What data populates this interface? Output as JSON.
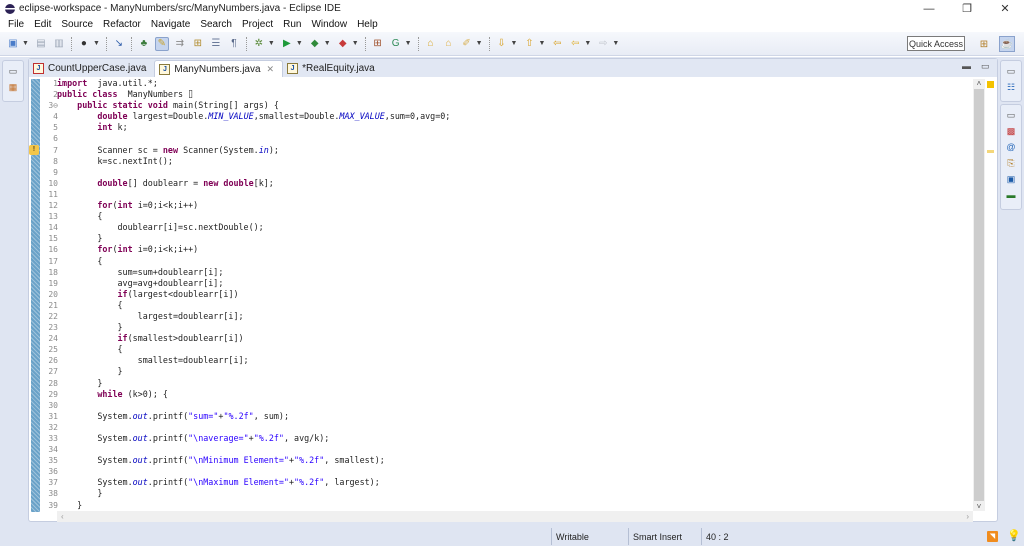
{
  "window": {
    "title": "eclipse-workspace - ManyNumbers/src/ManyNumbers.java - Eclipse IDE",
    "controls": {
      "minimize": "—",
      "restore": "❐",
      "close": "✕"
    }
  },
  "menu": [
    "File",
    "Edit",
    "Source",
    "Refactor",
    "Navigate",
    "Search",
    "Project",
    "Run",
    "Window",
    "Help"
  ],
  "toolbar": {
    "quick_access": "Quick Access",
    "icons": [
      {
        "name": "new-icon",
        "glyph": "▣",
        "color": "#4a7cc9",
        "dropdown": true
      },
      {
        "name": "save-icon",
        "glyph": "▤",
        "color": "#9aa4b4",
        "dropdown": false
      },
      {
        "name": "save-all-icon",
        "glyph": "▥",
        "color": "#9aa4b4",
        "dropdown": false
      },
      {
        "name": "sep"
      },
      {
        "name": "publish-icon",
        "glyph": "●",
        "color": "#333333",
        "dropdown": true
      },
      {
        "name": "sep"
      },
      {
        "name": "skip-breakpoints-icon",
        "glyph": "↘",
        "color": "#2a5aa8",
        "dropdown": false
      },
      {
        "name": "sep"
      },
      {
        "name": "toggle-breadcrumb-icon",
        "glyph": "♣",
        "color": "#3a7b3a",
        "dropdown": false
      },
      {
        "name": "mark-occurrences-icon",
        "glyph": "✎",
        "color": "#c9a32a",
        "dropdown": false,
        "active": true
      },
      {
        "name": "block-selection-icon",
        "glyph": "⇉",
        "color": "#8a8a8a",
        "dropdown": false
      },
      {
        "name": "word-wrap-icon",
        "glyph": "⊞",
        "color": "#b08a2a",
        "dropdown": false
      },
      {
        "name": "show-whitespace-list-icon",
        "glyph": "☰",
        "color": "#6a7a9a",
        "dropdown": false
      },
      {
        "name": "pilcrow-icon",
        "glyph": "¶",
        "color": "#5a6a8a",
        "dropdown": false
      },
      {
        "name": "sep"
      },
      {
        "name": "debug-icon",
        "glyph": "✲",
        "color": "#5a8a3a",
        "dropdown": true
      },
      {
        "name": "run-icon",
        "glyph": "▶",
        "color": "#1e9a3a",
        "dropdown": true
      },
      {
        "name": "coverage-icon",
        "glyph": "◆",
        "color": "#2f8a3a",
        "dropdown": true
      },
      {
        "name": "external-tools-icon",
        "glyph": "◆",
        "color": "#c73a3a",
        "dropdown": true
      },
      {
        "name": "sep"
      },
      {
        "name": "new-java-package-icon",
        "glyph": "⊞",
        "color": "#a0522d",
        "dropdown": false
      },
      {
        "name": "new-java-class-icon",
        "glyph": "G",
        "color": "#2e8b57",
        "dropdown": true
      },
      {
        "name": "sep"
      },
      {
        "name": "open-type-icon",
        "glyph": "⌂",
        "color": "#d9a72a",
        "dropdown": false
      },
      {
        "name": "open-folder-icon",
        "glyph": "⌂",
        "color": "#e0b040",
        "dropdown": false
      },
      {
        "name": "search-icon",
        "glyph": "✐",
        "color": "#d8b050",
        "dropdown": true
      },
      {
        "name": "sep"
      },
      {
        "name": "next-annotation-icon",
        "glyph": "⇩",
        "color": "#d8a020",
        "dropdown": true
      },
      {
        "name": "prev-annotation-icon",
        "glyph": "⇧",
        "color": "#d8a020",
        "dropdown": true
      },
      {
        "name": "last-edit-location-icon",
        "glyph": "⇦",
        "color": "#d8a020",
        "dropdown": false
      },
      {
        "name": "back-icon",
        "glyph": "⇦",
        "color": "#e0b030",
        "dropdown": true
      },
      {
        "name": "forward-icon",
        "glyph": "⇨",
        "color": "#c0c4cc",
        "dropdown": true
      }
    ]
  },
  "editor": {
    "tabs": [
      {
        "label": "CountUpperCase.java",
        "active": false,
        "dirty": false,
        "error": true
      },
      {
        "label": "ManyNumbers.java",
        "active": true,
        "dirty": false,
        "error": false
      },
      {
        "label": "*RealEquity.java",
        "active": false,
        "dirty": true,
        "error": false
      }
    ],
    "lines": [
      [
        [
          "kw",
          "import"
        ],
        [
          "",
          "  java.util.*;"
        ]
      ],
      [
        [
          "kw",
          "public class"
        ],
        [
          "",
          "  ManyNumbers ⌷"
        ]
      ],
      [
        [
          "",
          "    "
        ],
        [
          "kw",
          "public static void"
        ],
        [
          "",
          " main(String[] args) {"
        ]
      ],
      [
        [
          "",
          "        "
        ],
        [
          "kw",
          "double"
        ],
        [
          "",
          " largest=Double."
        ],
        [
          "sf",
          "MIN_VALUE"
        ],
        [
          "",
          ",smallest=Double."
        ],
        [
          "sf",
          "MAX_VALUE"
        ],
        [
          "",
          ",sum=0,avg=0;"
        ]
      ],
      [
        [
          "",
          "        "
        ],
        [
          "kw",
          "int"
        ],
        [
          "",
          " k;"
        ]
      ],
      [],
      [
        [
          "",
          "        Scanner sc = "
        ],
        [
          "kw",
          "new"
        ],
        [
          "",
          " Scanner(System."
        ],
        [
          "sf",
          "in"
        ],
        [
          "",
          ");"
        ]
      ],
      [
        [
          "",
          "        k=sc.nextInt();"
        ]
      ],
      [],
      [
        [
          "",
          "        "
        ],
        [
          "kw",
          "double"
        ],
        [
          "",
          "[] doublearr = "
        ],
        [
          "kw",
          "new double"
        ],
        [
          "",
          "[k];"
        ]
      ],
      [],
      [
        [
          "",
          "        "
        ],
        [
          "kw",
          "for"
        ],
        [
          "",
          "("
        ],
        [
          "kw",
          "int"
        ],
        [
          "",
          " i=0;i<k;i++)"
        ]
      ],
      [
        [
          "",
          "        {"
        ]
      ],
      [
        [
          "",
          "            doublearr[i]=sc.nextDouble();"
        ]
      ],
      [
        [
          "",
          "        }"
        ]
      ],
      [
        [
          "",
          "        "
        ],
        [
          "kw",
          "for"
        ],
        [
          "",
          "("
        ],
        [
          "kw",
          "int"
        ],
        [
          "",
          " i=0;i<k;i++)"
        ]
      ],
      [
        [
          "",
          "        {"
        ]
      ],
      [
        [
          "",
          "            sum=sum+doublearr[i];"
        ]
      ],
      [
        [
          "",
          "            avg=avg+doublearr[i];"
        ]
      ],
      [
        [
          "",
          "            "
        ],
        [
          "kw",
          "if"
        ],
        [
          "",
          "(largest<doublearr[i])"
        ]
      ],
      [
        [
          "",
          "            {"
        ]
      ],
      [
        [
          "",
          "                largest=doublearr[i];"
        ]
      ],
      [
        [
          "",
          "            }"
        ]
      ],
      [
        [
          "",
          "            "
        ],
        [
          "kw",
          "if"
        ],
        [
          "",
          "(smallest>doublearr[i])"
        ]
      ],
      [
        [
          "",
          "            {"
        ]
      ],
      [
        [
          "",
          "                smallest=doublearr[i];"
        ]
      ],
      [
        [
          "",
          "            }"
        ]
      ],
      [
        [
          "",
          "        }"
        ]
      ],
      [
        [
          "",
          "        "
        ],
        [
          "kw",
          "while"
        ],
        [
          "",
          " (k>0); {"
        ]
      ],
      [],
      [
        [
          "",
          "        System."
        ],
        [
          "sf",
          "out"
        ],
        [
          "",
          ".printf("
        ],
        [
          "st",
          "\"sum=\""
        ],
        [
          "",
          "+"
        ],
        [
          "st",
          "\"%.2f\""
        ],
        [
          "",
          ", sum);"
        ]
      ],
      [],
      [
        [
          "",
          "        System."
        ],
        [
          "sf",
          "out"
        ],
        [
          "",
          ".printf("
        ],
        [
          "st",
          "\"\\naverage=\""
        ],
        [
          "",
          "+"
        ],
        [
          "st",
          "\"%.2f\""
        ],
        [
          "",
          ", avg/k);"
        ]
      ],
      [],
      [
        [
          "",
          "        System."
        ],
        [
          "sf",
          "out"
        ],
        [
          "",
          ".printf("
        ],
        [
          "st",
          "\"\\nMinimum Element=\""
        ],
        [
          "",
          "+"
        ],
        [
          "st",
          "\"%.2f\""
        ],
        [
          "",
          ", smallest);"
        ]
      ],
      [],
      [
        [
          "",
          "        System."
        ],
        [
          "sf",
          "out"
        ],
        [
          "",
          ".printf("
        ],
        [
          "st",
          "\"\\nMaximum Element=\""
        ],
        [
          "",
          "+"
        ],
        [
          "st",
          "\"%.2f\""
        ],
        [
          "",
          ", largest);"
        ]
      ],
      [
        [
          "",
          "        }"
        ]
      ],
      [
        [
          "",
          "    }"
        ]
      ]
    ],
    "folding_marker_line": 3
  },
  "statusbar": {
    "writable": "Writable",
    "insert_mode": "Smart Insert",
    "cursor_position": "40 : 2"
  },
  "colors": {
    "keyword": "#7f0055",
    "string": "#2a00ff",
    "static_field": "#0000c0",
    "chrome": "#dfe5f2"
  }
}
